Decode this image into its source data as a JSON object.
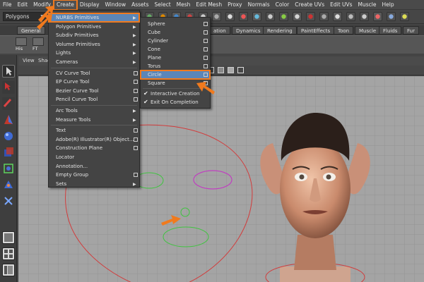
{
  "menubar": [
    "File",
    "Edit",
    "Modify",
    "Create",
    "Display",
    "Window",
    "Assets",
    "Select",
    "Mesh",
    "Edit Mesh",
    "Proxy",
    "Normals",
    "Color",
    "Create UVs",
    "Edit UVs",
    "Muscle",
    "Help"
  ],
  "mode_selector": "Polygons",
  "shelf": {
    "tabs": [
      "General",
      "ation",
      "Dynamics",
      "Rendering",
      "PaintEffects",
      "Toon",
      "Muscle",
      "Fluids",
      "Fur"
    ],
    "icon_labels": [
      "His",
      "FT"
    ]
  },
  "panel_menu": [
    "View",
    "Shac"
  ],
  "create_menu": {
    "items": [
      {
        "label": "NURBS Primitives",
        "submenu": true,
        "highlighted": true
      },
      {
        "label": "Polygon Primitives",
        "submenu": true
      },
      {
        "label": "Subdiv Primitives",
        "submenu": true
      },
      {
        "label": "Volume Primitives",
        "submenu": true
      },
      {
        "label": "Lights",
        "submenu": true
      },
      {
        "label": "Cameras",
        "submenu": true
      },
      {
        "label": "CV Curve Tool",
        "option": true
      },
      {
        "label": "EP Curve Tool",
        "option": true
      },
      {
        "label": "Bezier Curve Tool",
        "option": true
      },
      {
        "label": "Pencil Curve Tool",
        "option": true
      },
      {
        "label": "Arc Tools",
        "submenu": true
      },
      {
        "label": "Measure Tools",
        "submenu": true
      },
      {
        "label": "Text",
        "option": true
      },
      {
        "label": "Adobe(R) Illustrator(R) Object...",
        "option": true
      },
      {
        "label": "Construction Plane",
        "option": true
      },
      {
        "label": "Locator"
      },
      {
        "label": "Annotation..."
      },
      {
        "label": "Empty Group",
        "option": true
      },
      {
        "label": "Sets",
        "submenu": true
      }
    ]
  },
  "nurbs_submenu": {
    "items": [
      {
        "label": "Sphere",
        "option": true
      },
      {
        "label": "Cube",
        "option": true
      },
      {
        "label": "Cylinder",
        "option": true
      },
      {
        "label": "Cone",
        "option": true
      },
      {
        "label": "Plane",
        "option": true
      },
      {
        "label": "Torus",
        "option": true
      },
      {
        "label": "Circle",
        "option": true,
        "highlighted": true
      },
      {
        "label": "Square",
        "option": true
      },
      {
        "label": "Interactive Creation",
        "checked": true
      },
      {
        "label": "Exit On Completion",
        "checked": true
      }
    ]
  },
  "colors": {
    "highlight": "#5b86b8",
    "annotation": "#f07a1e",
    "viewport": "#a4a4a4",
    "curve_red": "#d23c3c",
    "curve_green": "#3fc43f",
    "curve_magenta": "#c03fc0"
  }
}
